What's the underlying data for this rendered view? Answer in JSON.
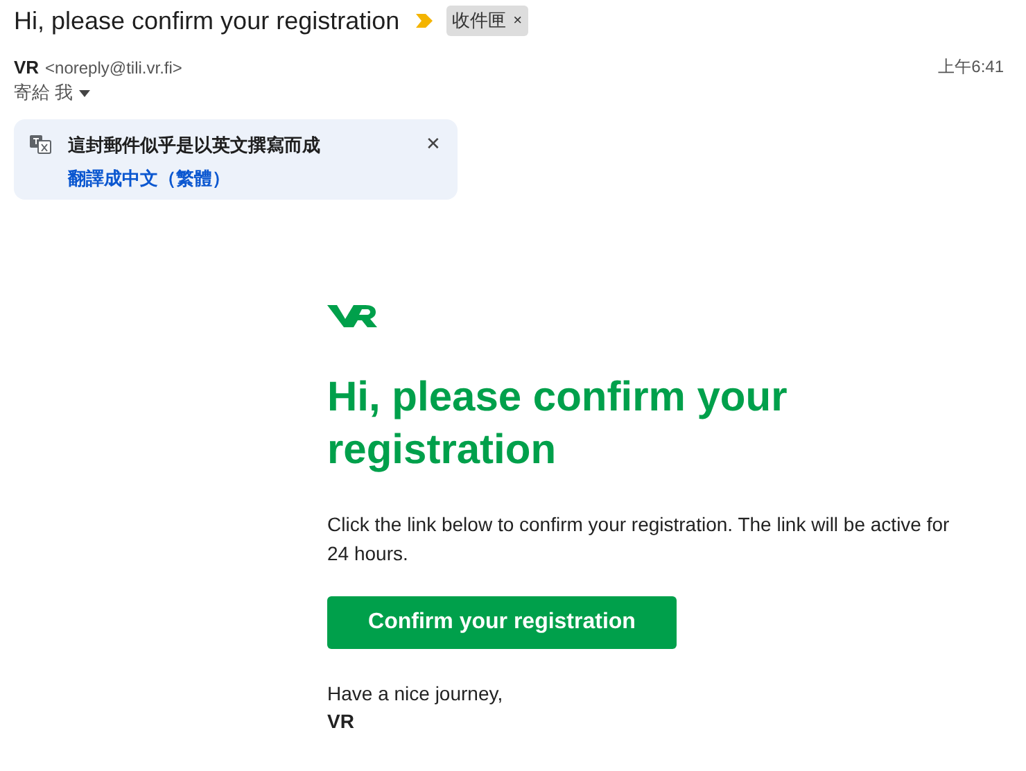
{
  "subject": "Hi, please confirm your registration",
  "important": true,
  "label": {
    "text": "收件匣",
    "close": "×"
  },
  "sender": {
    "name": "VR",
    "address": "<noreply@tili.vr.fi>",
    "to": "寄給 我",
    "time": "上午6:41"
  },
  "translate": {
    "message": "這封郵件似乎是以英文撰寫而成",
    "link": "翻譯成中文（繁體）",
    "close": "✕"
  },
  "body": {
    "heading": "Hi, please confirm your registration",
    "text": "Click the link below to confirm your registration. The link will be active for 24 hours.",
    "button": "Confirm your registration",
    "closing": "Have a nice journey,",
    "signature": "VR"
  }
}
